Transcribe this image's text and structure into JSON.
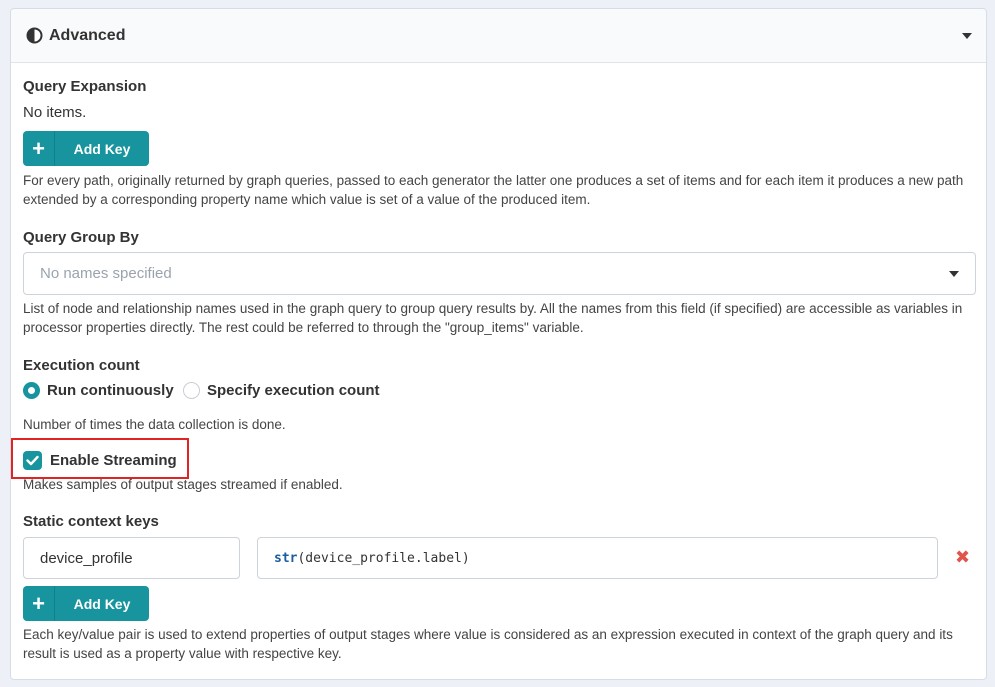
{
  "panel": {
    "title": "Advanced",
    "icon": "half-circle-icon"
  },
  "query_expansion": {
    "label": "Query Expansion",
    "empty_text": "No items.",
    "add_button": "Add Key",
    "help": "For every path, originally returned by graph queries, passed to each generator the latter one produces a set of items and for each item it produces a new path extended by a corresponding property name which value is set of a value of the produced item."
  },
  "query_group_by": {
    "label": "Query Group By",
    "placeholder": "No names specified",
    "help": "List of node and relationship names used in the graph query to group query results by. All the names from this field (if specified) are accessible as variables in processor properties directly. The rest could be referred to through the \"group_items\" variable."
  },
  "execution_count": {
    "label": "Execution count",
    "options": [
      {
        "label": "Run continuously",
        "selected": true
      },
      {
        "label": "Specify execution count",
        "selected": false
      }
    ],
    "help": "Number of times the data collection is done."
  },
  "streaming": {
    "label": "Enable Streaming",
    "checked": true,
    "help": "Makes samples of output stages streamed if enabled."
  },
  "static_context_keys": {
    "label": "Static context keys",
    "rows": [
      {
        "key": "device_profile",
        "value_fn": "str",
        "value_rest": "(device_profile.label)"
      }
    ],
    "add_button": "Add Key",
    "help": "Each key/value pair is used to extend properties of output stages where value is considered as an expression executed in context of the graph query and its result is used as a property value with respective key."
  },
  "colors": {
    "accent": "#17949d",
    "highlight": "#e02424",
    "remove": "#e0544b"
  }
}
